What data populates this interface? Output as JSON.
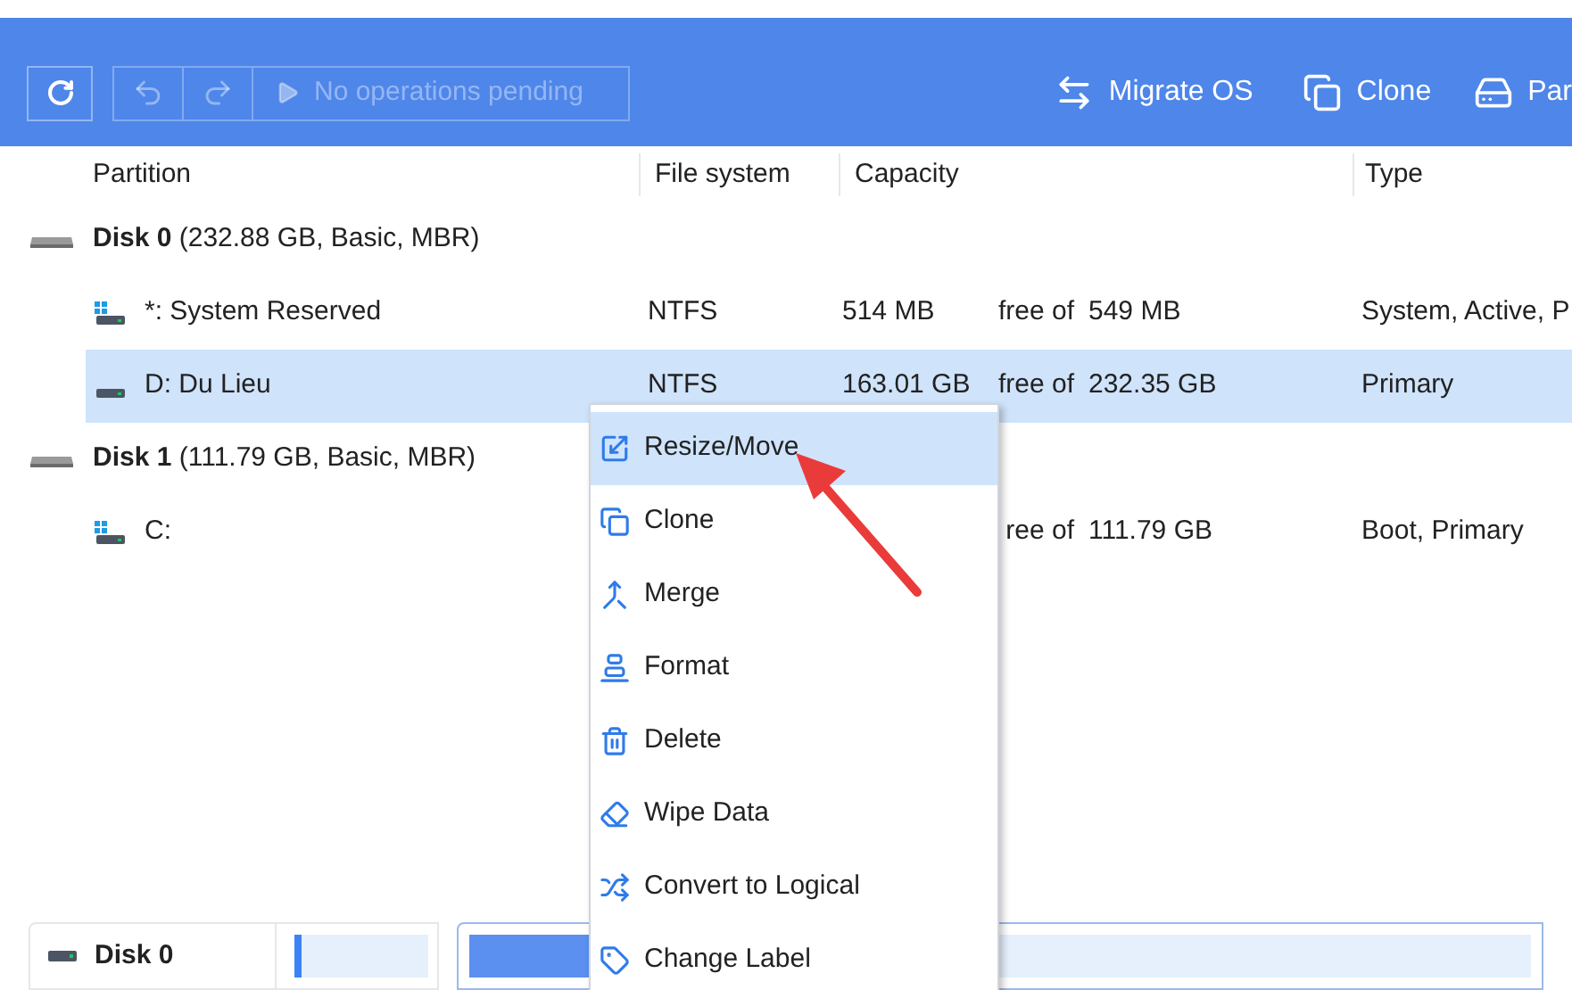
{
  "toolbar": {
    "apply_label": "No operations pending",
    "actions": [
      {
        "label": "Migrate OS"
      },
      {
        "label": "Clone"
      },
      {
        "label": "Par"
      }
    ]
  },
  "table": {
    "columns": [
      "Partition",
      "File system",
      "Capacity",
      "Type"
    ],
    "rows": [
      {
        "kind": "disk",
        "name": "**Disk 0** (232.88 GB, Basic, MBR)",
        "selected": false
      },
      {
        "kind": "system_partition",
        "name": "*: System Reserved",
        "file_system": "NTFS",
        "used": "514 MB",
        "free_of": "free of",
        "total": "549 MB",
        "type": "System, Active, P",
        "selected": false
      },
      {
        "kind": "partition",
        "name": "D: Du Lieu",
        "file_system": "NTFS",
        "used": "163.01 GB",
        "free_of": "free of",
        "total": "232.35 GB",
        "type": "Primary",
        "selected": true
      },
      {
        "kind": "disk",
        "name": "**Disk 1** (111.79 GB, Basic, MBR)",
        "selected": false
      },
      {
        "kind": "system_partition",
        "name": "C:",
        "free_of": "ree of",
        "total": "111.79 GB",
        "type": "Boot, Primary",
        "selected": false
      }
    ]
  },
  "context_menu": [
    {
      "label": "Resize/Move",
      "selected": true
    },
    {
      "label": "Clone",
      "selected": false
    },
    {
      "label": "Merge",
      "selected": false
    },
    {
      "label": "Format",
      "selected": false
    },
    {
      "label": "Delete",
      "selected": false
    },
    {
      "label": "Wipe Data",
      "selected": false
    },
    {
      "label": "Convert to Logical",
      "selected": false
    },
    {
      "label": "Change Label",
      "selected": false
    }
  ],
  "disk_map": {
    "label": "Disk 0"
  }
}
